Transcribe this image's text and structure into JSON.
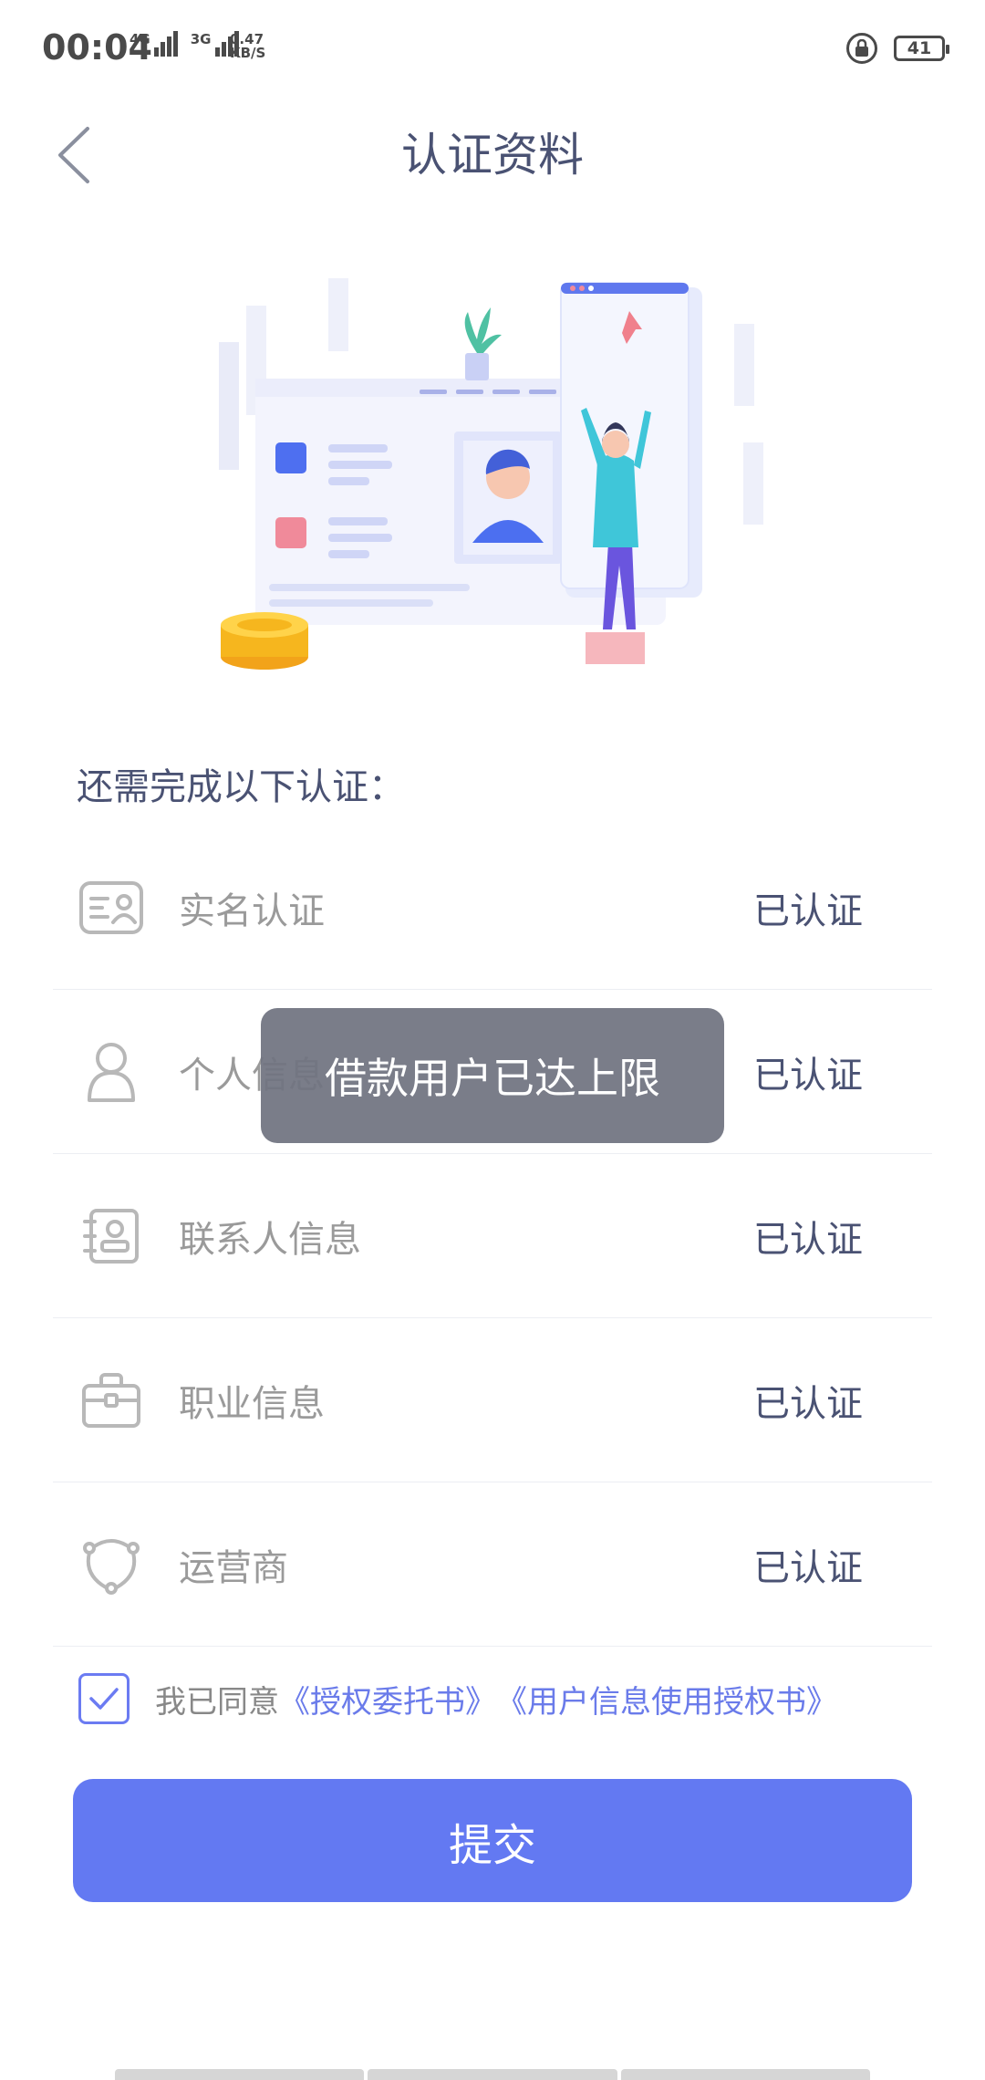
{
  "status_bar": {
    "time": "00:04",
    "net1": "4G",
    "net2": "3G",
    "speed_value": "0.47",
    "speed_unit": "KB/S",
    "battery": "41"
  },
  "header": {
    "title": "认证资料"
  },
  "section": {
    "title": "还需完成以下认证："
  },
  "auth_items": [
    {
      "label": "实名认证",
      "status": "已认证",
      "icon": "id-card-icon"
    },
    {
      "label": "个人信息",
      "status": "已认证",
      "icon": "person-icon"
    },
    {
      "label": "联系人信息",
      "status": "已认证",
      "icon": "contacts-icon"
    },
    {
      "label": "职业信息",
      "status": "已认证",
      "icon": "briefcase-icon"
    },
    {
      "label": "运营商",
      "status": "已认证",
      "icon": "operator-icon"
    }
  ],
  "toast": {
    "message": "借款用户已达上限"
  },
  "agreement": {
    "checked": true,
    "prefix": "我已同意",
    "link1": "《授权委托书》",
    "link2": "《用户信息使用授权书》"
  },
  "submit": {
    "label": "提交"
  },
  "colors": {
    "primary": "#6379f2",
    "title_text": "#4a5273",
    "muted_text": "#9a9a9a",
    "link": "#6a7bea",
    "toast_bg": "#707380"
  }
}
